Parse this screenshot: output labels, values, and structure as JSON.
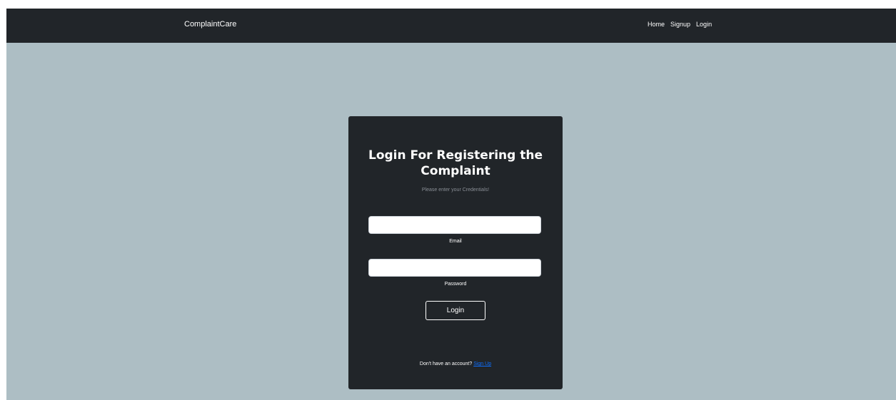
{
  "navbar": {
    "brand": "ComplaintCare",
    "links": [
      "Home",
      "Signup",
      "Login"
    ]
  },
  "card": {
    "title": "Login For Registering the Complaint",
    "subtitle": "Please enter your Credentials!",
    "email": {
      "value": "",
      "placeholder": "",
      "label": "Email"
    },
    "password": {
      "value": "",
      "placeholder": "",
      "label": "Password"
    },
    "login_button": "Login",
    "signup_prompt": "Don't have an account?",
    "signup_link": "Sign Up"
  },
  "colors": {
    "page_background": "#adbec4",
    "navbar_background": "#212529",
    "card_background": "#212529",
    "link": "#0d6efd",
    "text": "#ffffff"
  }
}
